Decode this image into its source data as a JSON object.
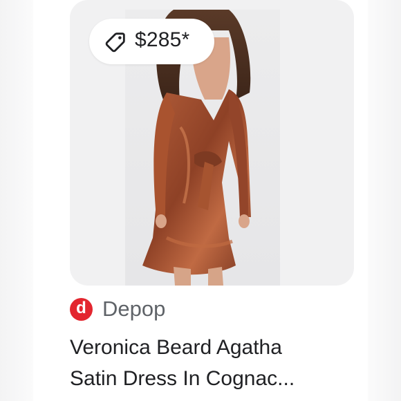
{
  "price": {
    "label": "$285*",
    "icon": "price-tag-icon"
  },
  "product_image": {
    "alt": "Veronica Beard Agatha Satin Dress In Cognac"
  },
  "source": {
    "logo_letter": "d",
    "logo_color": "#e3262f",
    "name": "Depop"
  },
  "title": {
    "line1": "Veronica Beard Agatha",
    "line2": "Satin Dress In Cognac..."
  },
  "colors": {
    "dress": "#9a4a2c",
    "text": "#202124",
    "muted": "#5f6368"
  }
}
